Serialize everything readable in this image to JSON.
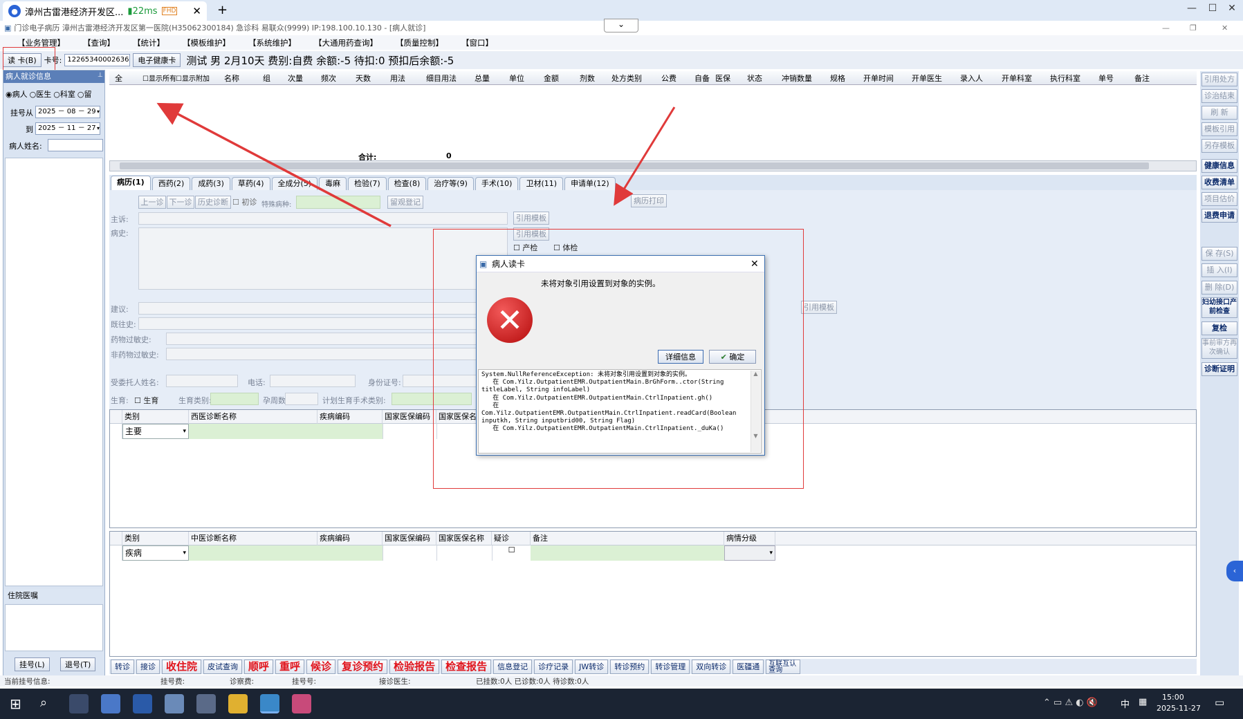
{
  "browser": {
    "tab_title": "漳州古雷港经济开发区...",
    "latency": "22ms",
    "quality": "FHD"
  },
  "app": {
    "title": "门诊电子病历  漳州古雷港经济开发区第一医院(H35062300184)  急诊科  易联众(9999) IP:198.100.10.130 - [病人就诊]"
  },
  "menu": [
    "【业务管理】",
    "【查询】",
    "【统计】",
    "【模板维护】",
    "【系统维护】",
    "【大通用药查询】",
    "【质量控制】",
    "【窗口】"
  ],
  "cardbar": {
    "read_card": "读 卡(B)",
    "card_label": "卡号:",
    "card_value": "122653400026366",
    "ehealth": "电子健康卡",
    "patient_info": "测试 男 2月10天 费别:自费 余额:-5 待扣:0 预扣后余额:-5"
  },
  "left": {
    "title": "病人就诊信息",
    "radios": [
      "病人",
      "医生",
      "科室",
      "留"
    ],
    "from_label": "挂号从",
    "from_date": "2025 － 08 － 29",
    "to_label": "到",
    "to_date": "2025 － 11 － 27",
    "name_label": "病人姓名:",
    "inpatient_label": "住院医嘱",
    "register": "挂号(L)",
    "unregister": "退号(T)"
  },
  "grid": {
    "columns": [
      "全",
      "显示所有",
      "显示附加",
      "名称",
      "组",
      "次量",
      "频次",
      "天数",
      "用法",
      "细目用法",
      "总量",
      "单位",
      "金额",
      "剂数",
      "处方类别",
      "公费",
      "自备",
      "医保",
      "状态",
      "冲销数量",
      "规格",
      "开单时间",
      "开单医生",
      "录入人",
      "开单科室",
      "执行科室",
      "单号",
      "备注"
    ],
    "total_label": "合计:",
    "total_value": "0"
  },
  "right_buttons": [
    {
      "label": "引用处方",
      "enabled": false
    },
    {
      "label": "诊治结束",
      "enabled": false
    },
    {
      "label": "刷 新",
      "enabled": false
    },
    {
      "label": "模板引用",
      "enabled": false
    },
    {
      "label": "另存模板",
      "enabled": false
    },
    {
      "label": "健康信息",
      "enabled": true
    },
    {
      "label": "收费清单",
      "enabled": true
    },
    {
      "label": "项目估价",
      "enabled": false
    },
    {
      "label": "退费申请",
      "enabled": true
    },
    {
      "label": "保 存(S)",
      "enabled": false
    },
    {
      "label": "插 入(I)",
      "enabled": false
    },
    {
      "label": "删 除(D)",
      "enabled": false
    },
    {
      "label": "妇幼接口产前检查",
      "enabled": true
    },
    {
      "label": "复检",
      "enabled": true
    },
    {
      "label": "事前审方再次确认",
      "enabled": false
    },
    {
      "label": "诊断证明",
      "enabled": true
    }
  ],
  "tabs": [
    "病历(1)",
    "西药(2)",
    "成药(3)",
    "草药(4)",
    "全成分(5)",
    "毒麻",
    "检验(7)",
    "检查(8)",
    "治疗等(9)",
    "手术(10)",
    "卫材(11)",
    "申请单(12)"
  ],
  "emr": {
    "prev": "上一诊",
    "next": "下一诊",
    "history": "历史诊断",
    "first_visit": "初诊",
    "special_disease": "特殊病种:",
    "observe": "留观登记",
    "print": "病历打印",
    "complaint": "主诉:",
    "history_label": "病史:",
    "cite_template": "引用模板",
    "antenatal": "产检",
    "physical": "体检",
    "suggestion": "建议:",
    "past_history": "既往史:",
    "drug_allergy": "药物过敏史:",
    "nondrug_allergy": "非药物过敏史:",
    "agent_name": "受委托人姓名:",
    "phone": "电话:",
    "id_no": "身份证号:",
    "fertility": "生育:",
    "fertility_chk": "生育",
    "fertility_type": "生育类别:",
    "gestational": "孕周数:",
    "surgery_type": "计划生育手术类别:"
  },
  "western_diag": {
    "columns": [
      "类别",
      "西医诊断名称",
      "疾病编码",
      "国家医保编码",
      "国家医保名"
    ],
    "row_type": "主要"
  },
  "tcm_diag": {
    "columns": [
      "类别",
      "中医诊断名称",
      "疾病编码",
      "国家医保编码",
      "国家医保名称",
      "疑诊",
      "备注",
      "病情分级"
    ],
    "row_type": "疾病"
  },
  "bottom_buttons": [
    {
      "label": "转诊",
      "red": false
    },
    {
      "label": "接诊",
      "red": false
    },
    {
      "label": "收住院",
      "red": true
    },
    {
      "label": "皮试查询",
      "red": false
    },
    {
      "label": "顺呼",
      "red": true
    },
    {
      "label": "重呼",
      "red": true
    },
    {
      "label": "候诊",
      "red": true
    },
    {
      "label": "复诊预约",
      "red": true
    },
    {
      "label": "检验报告",
      "red": true
    },
    {
      "label": "检查报告",
      "red": true
    },
    {
      "label": "信息登记",
      "red": false
    },
    {
      "label": "诊疗记录",
      "red": false
    },
    {
      "label": "JW转诊",
      "red": false
    },
    {
      "label": "转诊预约",
      "red": false
    },
    {
      "label": "转诊管理",
      "red": false
    },
    {
      "label": "双向转诊",
      "red": false
    },
    {
      "label": "医疆通",
      "red": false
    },
    {
      "label": "互联互认查询",
      "red": false
    }
  ],
  "status": {
    "current": "当前挂号信息:",
    "reg_fee": "挂号费:",
    "diag_fee": "诊察费:",
    "reg_no": "挂号号:",
    "doctor": "接诊医生:",
    "counts": "已挂数:0人  已诊数:0人  待诊数:0人"
  },
  "dialog": {
    "title": "病人读卡",
    "message": "未将对象引用设置到对象的实例。",
    "details_btn": "详细信息",
    "ok_btn": "确定",
    "detail_text": "System.NullReferenceException: 未将对象引用设置到对象的实例。\n   在 Com.Yilz.OutpatientEMR.OutpatientMain.BrGhForm..ctor(String titleLabel, String infoLabel)\n   在 Com.Yilz.OutpatientEMR.OutpatientMain.CtrlInpatient.gh()\n   在 Com.Yilz.OutpatientEMR.OutpatientMain.CtrlInpatient.readCard(Boolean inputkh, String inputbrid00, String Flag)\n   在 Com.Yilz.OutpatientEMR.OutpatientMain.CtrlInpatient._duKa()"
  },
  "taskbar": {
    "time": "15:00",
    "date": "2025-11-27",
    "ime": "中"
  },
  "colors": {
    "annotation": "#e03a3a",
    "accent": "#2b64d6",
    "error": "#c8101a"
  }
}
